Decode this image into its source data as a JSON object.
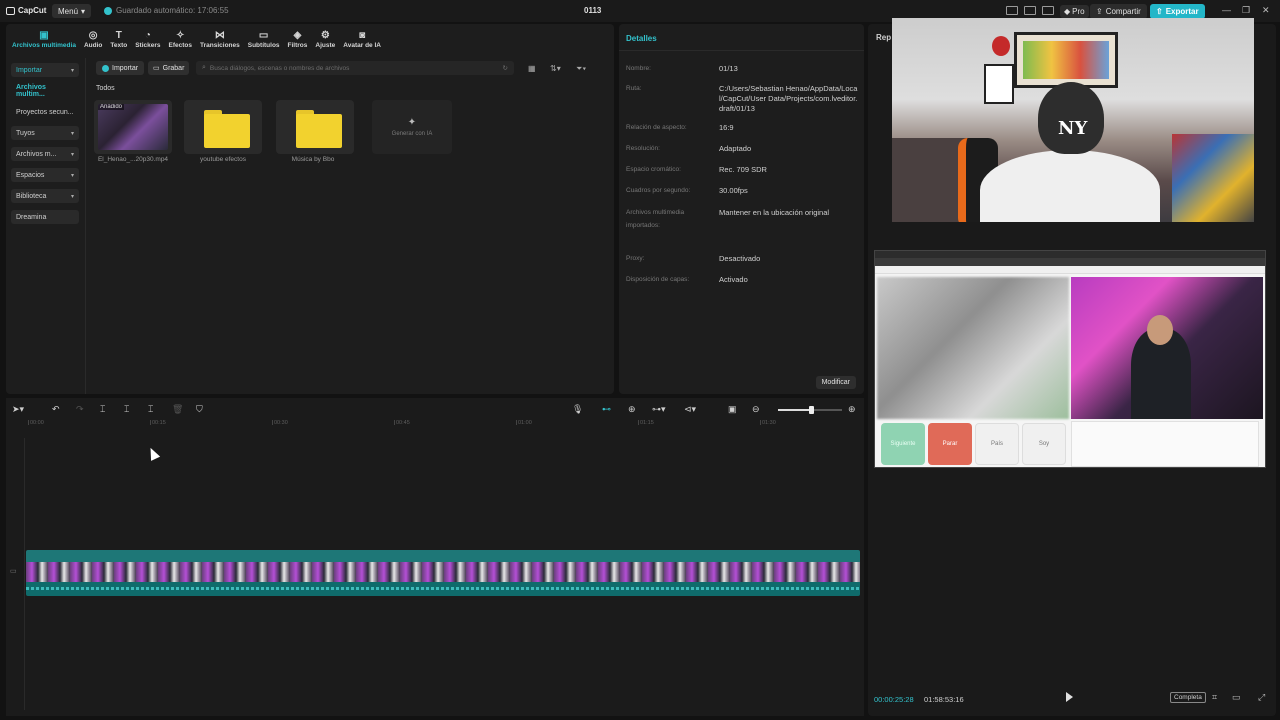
{
  "topbar": {
    "logo": "CapCut",
    "menu_label": "Menú",
    "autosave": "Guardado automático: 17:06:55",
    "project_title": "0113",
    "pro_label": "Pro",
    "share_label": "Compartir",
    "export_label": "Exportar"
  },
  "tools": [
    {
      "label": "Archivos multimedia",
      "icon": "media-icon"
    },
    {
      "label": "Audio",
      "icon": "audio-icon"
    },
    {
      "label": "Texto",
      "icon": "text-icon"
    },
    {
      "label": "Stickers",
      "icon": "sticker-icon"
    },
    {
      "label": "Efectos",
      "icon": "effects-icon"
    },
    {
      "label": "Transiciones",
      "icon": "transition-icon"
    },
    {
      "label": "Subtítulos",
      "icon": "subtitles-icon"
    },
    {
      "label": "Filtros",
      "icon": "filter-icon"
    },
    {
      "label": "Ajuste",
      "icon": "adjust-icon"
    },
    {
      "label": "Avatar de IA",
      "icon": "ai-avatar-icon"
    }
  ],
  "sidebar": {
    "items": [
      {
        "label": "Importar",
        "chev": "▾"
      },
      {
        "label": "Archivos multim...",
        "chev": ""
      },
      {
        "label": "Proyectos secun...",
        "chev": ""
      },
      {
        "label": "Tuyos",
        "chev": "▾"
      },
      {
        "label": "Archivos m...",
        "chev": "▾"
      },
      {
        "label": "Espacios",
        "chev": "▾"
      },
      {
        "label": "Biblioteca",
        "chev": "▾"
      },
      {
        "label": "Dreamina",
        "chev": ""
      }
    ]
  },
  "media": {
    "import_label": "Importar",
    "record_label": "Grabar",
    "search_placeholder": "Busca diálogos, escenas o nombres de archivos",
    "all_label": "Todos",
    "items": [
      {
        "name": "El_Henao_...20p30.mp4",
        "badge": "Añadido"
      },
      {
        "name": "youtube efectos"
      },
      {
        "name": "Música by Bbo"
      }
    ],
    "ai_label": "Generar con IA"
  },
  "details": {
    "title": "Detalles",
    "rows": [
      {
        "label": "Nombre:",
        "value": "01/13"
      },
      {
        "label": "Ruta:",
        "value": "C:/Users/Sebastian Henao/AppData/Local/CapCut/User Data/Projects/com.lveditor.draft/01/13"
      },
      {
        "label": "Relación de aspecto:",
        "value": "16:9"
      },
      {
        "label": "Resolución:",
        "value": "Adaptado"
      },
      {
        "label": "Espacio cromático:",
        "value": "Rec. 709 SDR"
      },
      {
        "label": "Cuadros por segundo:",
        "value": "30.00fps"
      },
      {
        "label": "Archivos multimedia importados:",
        "value": "Mantener en la ubicación original"
      },
      {
        "label": "Proxy:",
        "value": "Desactivado"
      },
      {
        "label": "Disposición de capas:",
        "value": "Activado"
      }
    ],
    "modify_label": "Modificar"
  },
  "player": {
    "label": "Rep",
    "time_current": "00:00:25:28",
    "time_total": "01:58:53:16",
    "full_label": "Completa",
    "screen": {
      "btn_next": "Siguiente",
      "btn_stop": "Parar",
      "btn_country": "País",
      "btn_soy": "Soy"
    }
  },
  "timeline": {
    "ticks": [
      "00:00",
      "00:15",
      "00:30",
      "00:45",
      "01:00",
      "01:15",
      "01:30"
    ],
    "zoom_level": 0.52
  },
  "colors": {
    "accent": "#33c2cc",
    "export": "#23b6c8"
  }
}
